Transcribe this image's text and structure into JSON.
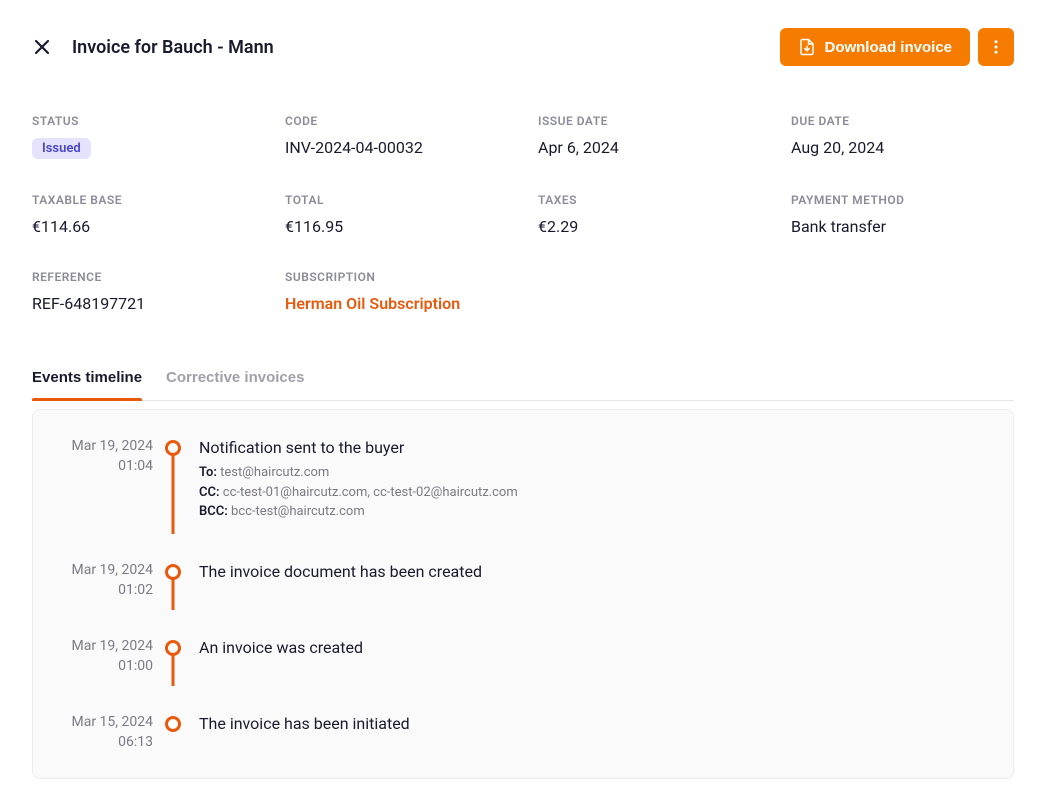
{
  "header": {
    "title": "Invoice for Bauch - Mann",
    "download_label": "Download invoice"
  },
  "details": {
    "status": {
      "label": "STATUS",
      "value": "Issued"
    },
    "code": {
      "label": "CODE",
      "value": "INV-2024-04-00032"
    },
    "issue_date": {
      "label": "ISSUE DATE",
      "value": "Apr 6, 2024"
    },
    "due_date": {
      "label": "DUE DATE",
      "value": "Aug 20, 2024"
    },
    "taxable_base": {
      "label": "TAXABLE BASE",
      "value": "€114.66"
    },
    "total": {
      "label": "TOTAL",
      "value": "€116.95"
    },
    "taxes": {
      "label": "TAXES",
      "value": "€2.29"
    },
    "payment_method": {
      "label": "PAYMENT METHOD",
      "value": "Bank transfer"
    },
    "reference": {
      "label": "REFERENCE",
      "value": "REF-648197721"
    },
    "subscription": {
      "label": "SUBSCRIPTION",
      "value": "Herman Oil Subscription"
    }
  },
  "tabs": {
    "events": "Events timeline",
    "corrective": "Corrective invoices"
  },
  "timeline": [
    {
      "date": "Mar 19, 2024",
      "time": "01:04",
      "title": "Notification sent to the buyer",
      "to_label": "To:",
      "to": "test@haircutz.com",
      "cc_label": "CC:",
      "cc": "cc-test-01@haircutz.com, cc-test-02@haircutz.com",
      "bcc_label": "BCC:",
      "bcc": "bcc-test@haircutz.com"
    },
    {
      "date": "Mar 19, 2024",
      "time": "01:02",
      "title": "The invoice document has been created"
    },
    {
      "date": "Mar 19, 2024",
      "time": "01:00",
      "title": "An invoice was created"
    },
    {
      "date": "Mar 15, 2024",
      "time": "06:13",
      "title": "The invoice has been initiated"
    }
  ]
}
